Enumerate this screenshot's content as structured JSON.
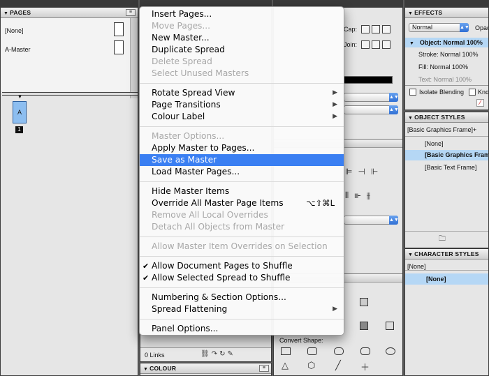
{
  "pages_panel": {
    "title": "PAGES",
    "items": [
      {
        "label": "[None]"
      },
      {
        "label": "A-Master"
      }
    ],
    "spread_page_label": "A",
    "page_number": "1"
  },
  "links_panel": {
    "count_label": "0 Links"
  },
  "colour_panel": {
    "title": "COLOUR"
  },
  "stroke_panel": {
    "cap_label": "Cap:",
    "join_label": "Join:"
  },
  "effects_panel": {
    "title": "EFFECTS",
    "blend_mode": "Normal",
    "opacity_label": "Opac",
    "object_row": "Object: Normal 100%",
    "stroke_row": "Stroke: Normal 100%",
    "fill_row": "Fill: Normal 100%",
    "text_row": "Text: Normal 100%",
    "isolate_label": "Isolate Blending",
    "knockout_label": "Kno"
  },
  "object_styles_panel": {
    "title": "OBJECT STYLES",
    "current": "[Basic Graphics Frame]+",
    "items": [
      {
        "label": "[None]"
      },
      {
        "label": "[Basic Graphics Frame]"
      },
      {
        "label": "[Basic Text Frame]"
      }
    ]
  },
  "character_styles_panel": {
    "title": "CHARACTER STYLES",
    "current": "[None]",
    "items": [
      {
        "label": "[None]"
      }
    ]
  },
  "pathfinder_panel": {
    "convert_shape_label": "Convert Shape:"
  },
  "context_menu": {
    "items": [
      {
        "label": "Insert Pages...",
        "disabled": false
      },
      {
        "label": "Move Pages...",
        "disabled": true
      },
      {
        "label": "New Master...",
        "disabled": false
      },
      {
        "label": "Duplicate Spread",
        "disabled": false
      },
      {
        "label": "Delete Spread",
        "disabled": true
      },
      {
        "label": "Select Unused Masters",
        "disabled": true
      },
      {
        "label": "Rotate Spread View",
        "disabled": false,
        "submenu": true
      },
      {
        "label": "Page Transitions",
        "disabled": false,
        "submenu": true
      },
      {
        "label": "Colour Label",
        "disabled": false,
        "submenu": true
      },
      {
        "label": "Master Options...",
        "disabled": true
      },
      {
        "label": "Apply Master to Pages...",
        "disabled": false
      },
      {
        "label": "Save as Master",
        "disabled": false,
        "highlighted": true
      },
      {
        "label": "Load Master Pages...",
        "disabled": false
      },
      {
        "label": "Hide Master Items",
        "disabled": false
      },
      {
        "label": "Override All Master Page Items",
        "disabled": false,
        "shortcut": "⌥⇧⌘L"
      },
      {
        "label": "Remove All Local Overrides",
        "disabled": true
      },
      {
        "label": "Detach All Objects from Master",
        "disabled": true
      },
      {
        "label": "Allow Master Item Overrides on Selection",
        "disabled": true
      },
      {
        "label": "Allow Document Pages to Shuffle",
        "disabled": false,
        "checked": true
      },
      {
        "label": "Allow Selected Spread to Shuffle",
        "disabled": false,
        "checked": true
      },
      {
        "label": "Numbering & Section Options...",
        "disabled": false
      },
      {
        "label": "Spread Flattening",
        "disabled": false,
        "submenu": true
      },
      {
        "label": "Panel Options...",
        "disabled": false
      }
    ]
  }
}
